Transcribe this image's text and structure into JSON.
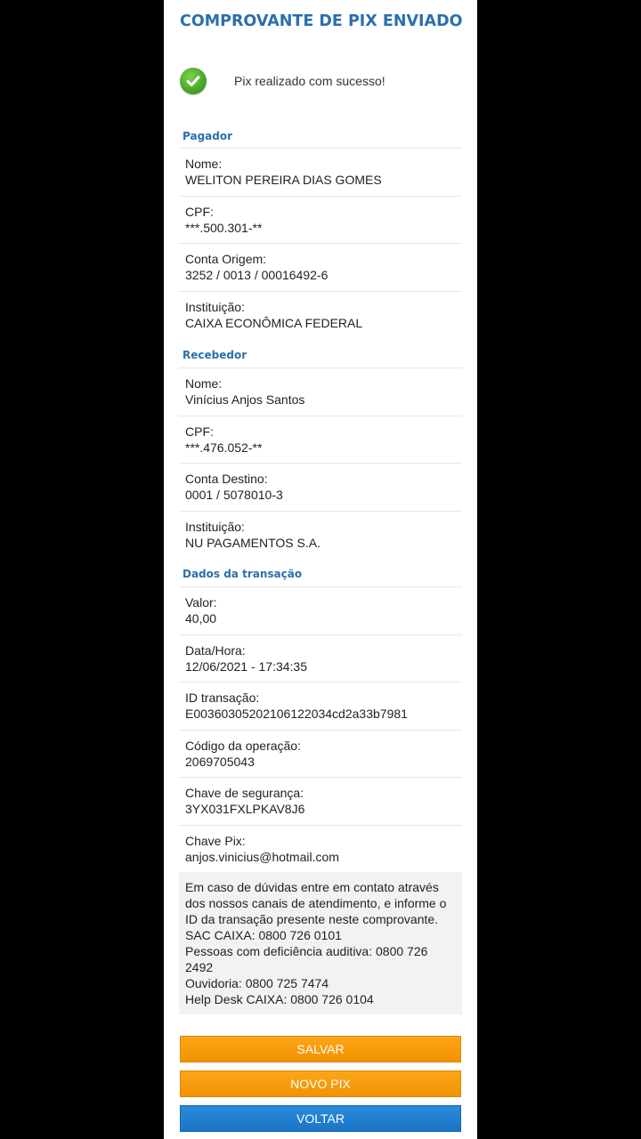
{
  "header": {
    "title": "COMPROVANTE DE PIX ENVIADO"
  },
  "status": {
    "icon": "check-circle-icon",
    "message": "Pix realizado com sucesso!"
  },
  "pagador": {
    "section_title": "Pagador",
    "rows": [
      {
        "label": "Nome:",
        "value": "WELITON PEREIRA DIAS GOMES"
      },
      {
        "label": "CPF:",
        "value": "***.500.301-**"
      },
      {
        "label": "Conta Origem:",
        "value": "3252 / 0013 / 00016492-6"
      },
      {
        "label": "Instituição:",
        "value": "CAIXA ECONÔMICA FEDERAL"
      }
    ]
  },
  "recebedor": {
    "section_title": "Recebedor",
    "rows": [
      {
        "label": "Nome:",
        "value": "Vinícius Anjos Santos"
      },
      {
        "label": "CPF:",
        "value": "***.476.052-**"
      },
      {
        "label": "Conta Destino:",
        "value": "0001 / 5078010-3"
      },
      {
        "label": "Instituição:",
        "value": "NU PAGAMENTOS S.A."
      }
    ]
  },
  "transacao": {
    "section_title": "Dados da transação",
    "rows": [
      {
        "label": "Valor:",
        "value": "40,00"
      },
      {
        "label": "Data/Hora:",
        "value": "12/06/2021 - 17:34:35"
      },
      {
        "label": "ID transação:",
        "value": "E00360305202106122034cd2a33b7981"
      },
      {
        "label": "Código da operação:",
        "value": "2069705043"
      },
      {
        "label": "Chave de segurança:",
        "value": "3YX031FXLPKAV8J6"
      },
      {
        "label": "Chave Pix:",
        "value": "anjos.vinicius@hotmail.com"
      }
    ]
  },
  "notice": {
    "intro": "Em caso de dúvidas entre em contato através dos nossos canais de atendimento, e informe o ID da transação presente neste comprovante.",
    "sac": "SAC CAIXA: 0800 726 0101",
    "deficiencia": "Pessoas com deficiência auditiva: 0800 726 2492",
    "ouvidoria": "Ouvidoria: 0800 725 7474",
    "helpdesk": "Help Desk CAIXA: 0800 726 0104"
  },
  "buttons": {
    "salvar": "SALVAR",
    "novo_pix": "NOVO PIX",
    "voltar": "VOLTAR"
  },
  "colors": {
    "title_blue": "#2a6fae",
    "orange_button": "#f39200",
    "blue_button": "#1a74c4",
    "success_green": "#46a628"
  }
}
